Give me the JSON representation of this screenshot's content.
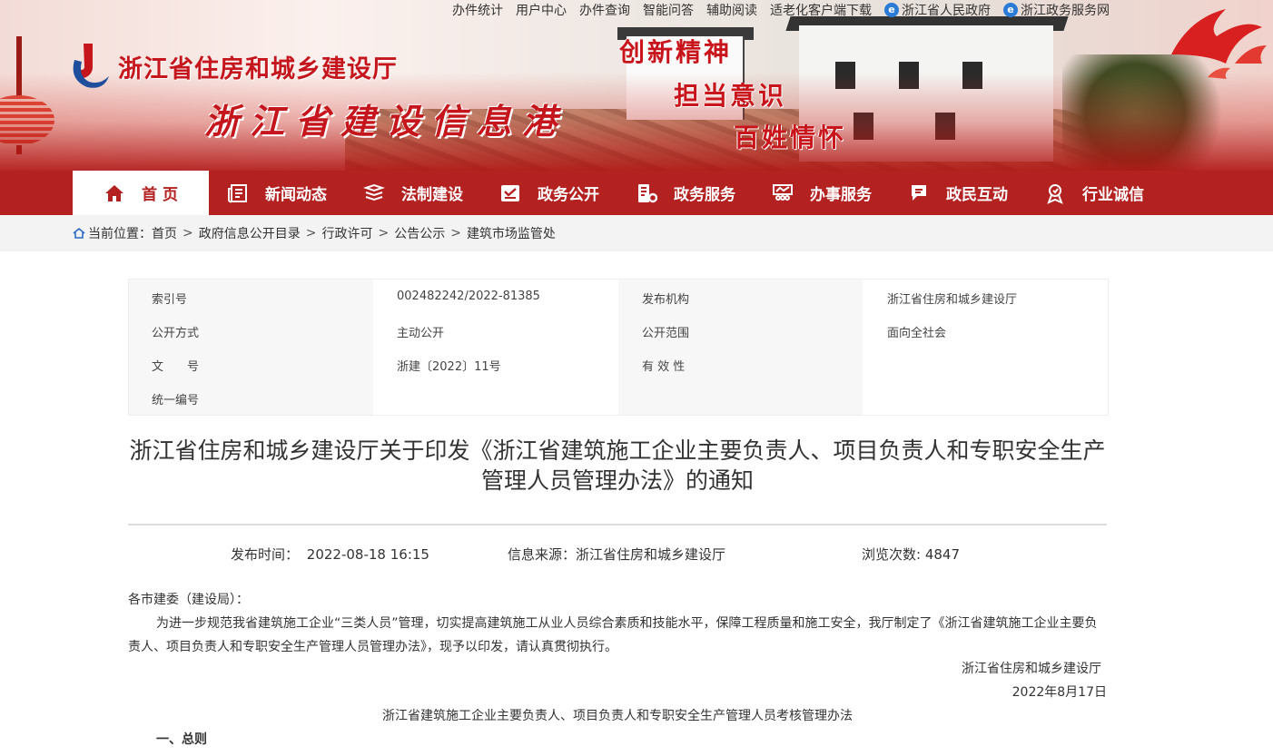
{
  "topbar": {
    "links": [
      "办件统计",
      "用户中心",
      "办件查询",
      "智能问答",
      "辅助阅读",
      "适老化客户端下载"
    ],
    "gov_link": "浙江省人民政府",
    "service_link": "浙江政务服务网"
  },
  "header": {
    "org_name": "浙江省住房和城乡建设厅",
    "site_name": "浙江省建设信息港",
    "mottos": [
      "创新精神",
      "担当意识",
      "百姓情怀"
    ]
  },
  "nav": {
    "items": [
      {
        "label": "首 页",
        "icon": "home-icon"
      },
      {
        "label": "新闻动态",
        "icon": "newspaper-icon"
      },
      {
        "label": "法制建设",
        "icon": "books-icon"
      },
      {
        "label": "政务公开",
        "icon": "notice-icon"
      },
      {
        "label": "政务服务",
        "icon": "service-icon"
      },
      {
        "label": "办事服务",
        "icon": "meeting-icon"
      },
      {
        "label": "政民互动",
        "icon": "chat-icon"
      },
      {
        "label": "行业诚信",
        "icon": "award-icon"
      }
    ]
  },
  "breadcrumb": {
    "prefix": "当前位置：",
    "items": [
      "首页",
      "政府信息公开目录",
      "行政许可",
      "公告公示",
      "建筑市场监管处"
    ]
  },
  "meta": {
    "index_label": "索引号",
    "index_value": "002482242/2022-81385",
    "publisher_label": "发布机构",
    "publisher_value": "浙江省住房和城乡建设厅",
    "method_label": "公开方式",
    "method_value": "主动公开",
    "scope_label": "公开范围",
    "scope_value": "面向全社会",
    "docno_label": "文　　号",
    "docno_value": "浙建〔2022〕11号",
    "validity_label": "有 效 性",
    "validity_value": "",
    "unified_label": "统一编号",
    "unified_value": ""
  },
  "article": {
    "title_line1": "浙江省住房和城乡建设厅关于印发《浙江省建筑施工企业主要负责人、项目负责人和专职安全生产",
    "title_line2": "管理人员管理办法》的通知",
    "publish_label": "发布时间：",
    "publish_time": "2022-08-18 16:15",
    "source_label": "信息来源：",
    "source": "浙江省住房和城乡建设厅",
    "views_label": "浏览次数:",
    "views": "4847",
    "salutation": "各市建委（建设局）：",
    "body": "为进一步规范我省建筑施工企业“三类人员”管理，切实提高建筑施工从业人员综合素质和技能水平，保障工程质量和施工安全，我厅制定了《浙江省建筑施工企业主要负责人、项目负责人和专职安全生产管理人员管理办法》，现予以印发，请认真贯彻执行。",
    "signature": "浙江省住房和城乡建设厅",
    "date": "2022年8月17日",
    "attachment_title": "浙江省建筑施工企业主要负责人、项目负责人和专职安全生产管理人员考核管理办法",
    "section_1": "一、总则"
  },
  "colors": {
    "brand_red": "#b42121",
    "title_red": "#c4161c"
  }
}
